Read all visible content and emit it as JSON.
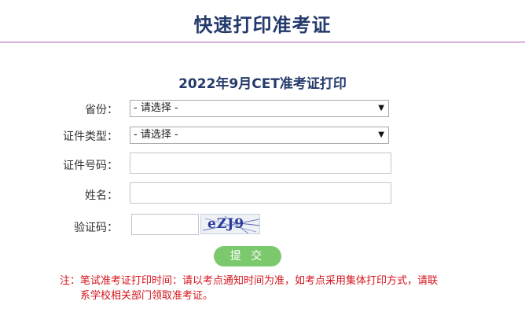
{
  "header": {
    "title": "快速打印准考证"
  },
  "form": {
    "title": "2022年9月CET准考证打印",
    "province_label": "省份：",
    "province_value": "- 请选择 -",
    "id_type_label": "证件类型：",
    "id_type_value": "- 请选择 -",
    "id_number_label": "证件号码：",
    "name_label": "姓名：",
    "captcha_label": "验证码：",
    "captcha_text": "eZJ9",
    "submit_label": "提 交"
  },
  "notice": {
    "line1": "注：笔试准考证打印时间：请以考点通知时间为准，如考点采用集体打印方式，请联",
    "line2": "系学校相关部门领取准考证。"
  },
  "colors": {
    "title": "#243a6b",
    "rule": "#b45ab4",
    "button": "#7cc96d",
    "notice": "#d4141b"
  },
  "icons": {
    "select_arrow": "triangle-down-icon"
  }
}
